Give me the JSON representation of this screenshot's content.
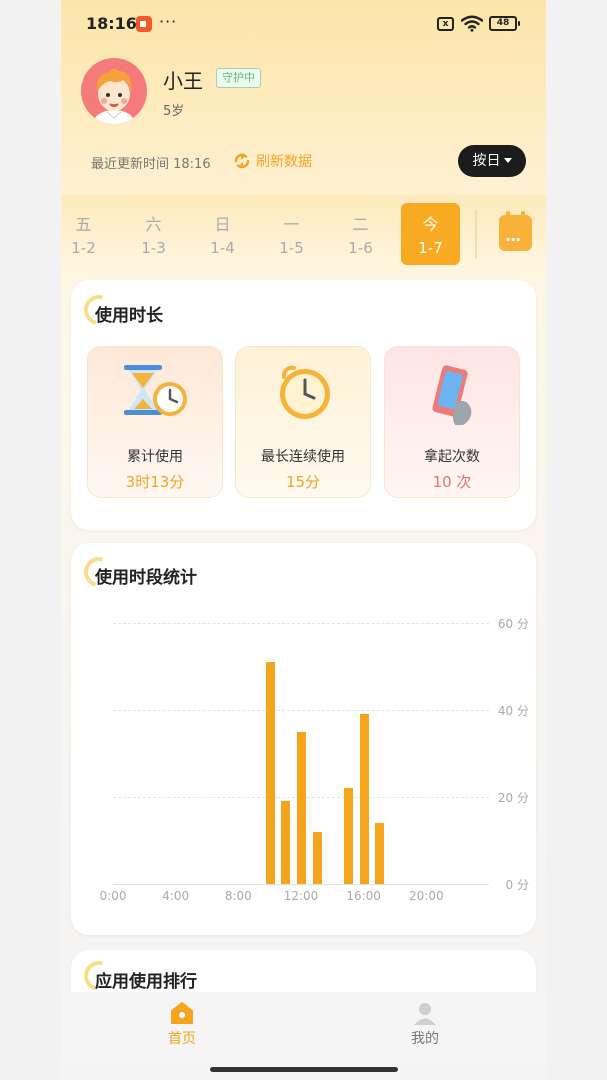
{
  "status_bar": {
    "time": "18:16",
    "battery": "48",
    "sim": "x"
  },
  "profile": {
    "name": "小王",
    "status_badge": "守护中",
    "age": "5岁"
  },
  "update": {
    "last_updated": "最近更新时间 18:16",
    "refresh_label": "刷新数据",
    "view_mode": "按日"
  },
  "dates": [
    {
      "weekday": "五",
      "date": "1-2"
    },
    {
      "weekday": "六",
      "date": "1-3"
    },
    {
      "weekday": "日",
      "date": "1-4"
    },
    {
      "weekday": "一",
      "date": "1-5"
    },
    {
      "weekday": "二",
      "date": "1-6"
    },
    {
      "weekday": "今",
      "date": "1-7",
      "active": true
    }
  ],
  "usage": {
    "title": "使用时长",
    "stats": [
      {
        "label": "累计使用",
        "value": "3时13分",
        "icon": "hourglass-clock-icon",
        "color": "#f3a327"
      },
      {
        "label": "最长连续使用",
        "value": "15分",
        "icon": "alarm-clock-icon",
        "color": "#f3a327"
      },
      {
        "label": "拿起次数",
        "value": "10 次",
        "icon": "phone-in-hand-icon",
        "color": "#e8716f"
      }
    ]
  },
  "period": {
    "title": "使用时段统计"
  },
  "chart_data": {
    "type": "bar",
    "x": [
      "10:00",
      "11:00",
      "12:00",
      "13:00",
      "15:00",
      "16:00",
      "17:00"
    ],
    "values": [
      51,
      19,
      35,
      12,
      22,
      39,
      14
    ],
    "x_ticks": [
      "0:00",
      "4:00",
      "8:00",
      "12:00",
      "16:00",
      "20:00"
    ],
    "y_ticks": [
      "60 分",
      "40 分",
      "20 分",
      "0 分"
    ],
    "ylim": [
      0,
      60
    ],
    "xlim": [
      0,
      24
    ],
    "grid": true,
    "bar_color": "#f5a51c"
  },
  "ranking": {
    "title": "应用使用排行"
  },
  "nav": [
    {
      "label": "首页",
      "icon": "home-icon",
      "active": true
    },
    {
      "label": "我的",
      "icon": "profile-icon",
      "active": false
    }
  ],
  "colors": {
    "accent": "#f8aa22",
    "active_date": "#f8aa22",
    "badge_green": "#5fbf76"
  }
}
